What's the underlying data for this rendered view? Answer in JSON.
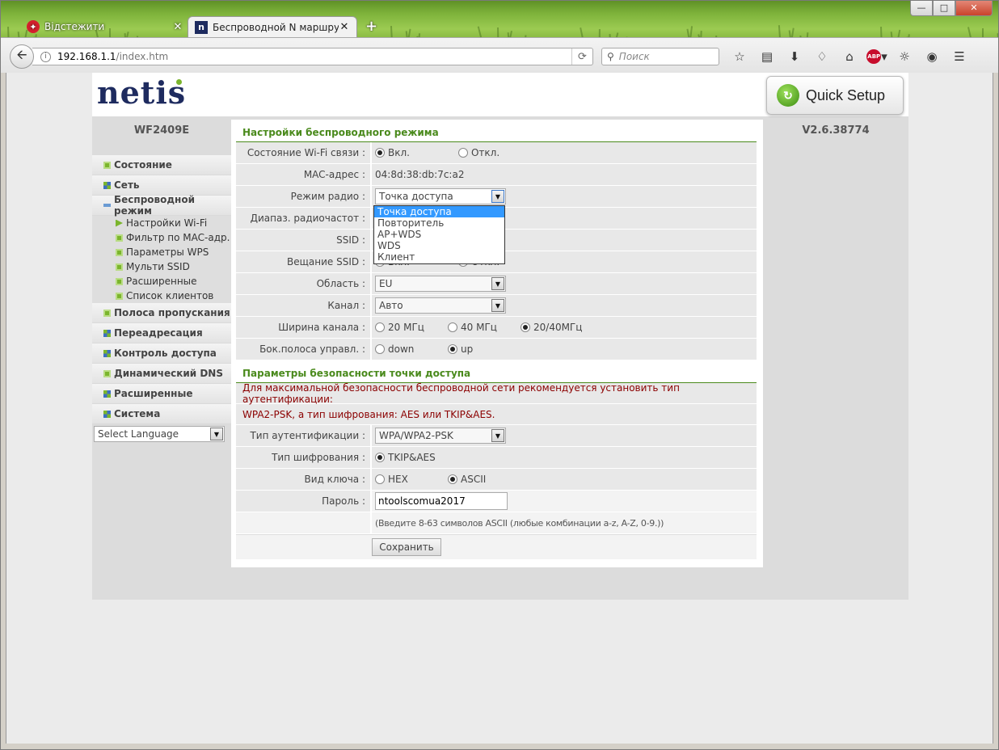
{
  "browser": {
    "tabs": [
      {
        "title": "Відстежити",
        "icon": "vivaldi-icon"
      },
      {
        "title": "Беспроводной N маршру...",
        "icon": "netis-favicon"
      }
    ],
    "url_host": "192.168.1.1",
    "url_path": "/index.htm",
    "search_placeholder": "Поиск",
    "abp_label": "ABP"
  },
  "header": {
    "logo": "netis",
    "quick_setup": "Quick Setup"
  },
  "sidebar": {
    "model": "WF2409E",
    "items": [
      {
        "label": "Состояние",
        "icon": "plus"
      },
      {
        "label": "Сеть",
        "icon": "grid"
      },
      {
        "label": "Беспроводной режим",
        "icon": "minus"
      }
    ],
    "subitems": [
      {
        "label": "Настройки Wi-Fi"
      },
      {
        "label": "Фильтр по MAC-адр."
      },
      {
        "label": "Параметры WPS"
      },
      {
        "label": "Мульти SSID"
      },
      {
        "label": "Расширенные"
      },
      {
        "label": "Список клиентов"
      }
    ],
    "items2": [
      {
        "label": "Полоса пропускания",
        "icon": "plus"
      },
      {
        "label": "Переадресация",
        "icon": "grid"
      },
      {
        "label": "Контроль доступа",
        "icon": "grid"
      },
      {
        "label": "Динамический DNS",
        "icon": "plus"
      },
      {
        "label": "Расширенные",
        "icon": "grid"
      },
      {
        "label": "Система",
        "icon": "grid"
      }
    ],
    "language": "Select Language"
  },
  "version": "V2.6.38774",
  "wireless": {
    "section_title": "Настройки беспроводного режима",
    "wifi_status_label": "Состояние Wi-Fi связи :",
    "wifi_on": "Вкл.",
    "wifi_off": "Откл.",
    "mac_label": "MAC-адрес :",
    "mac_value": "04:8d:38:db:7c:a2",
    "radio_mode_label": "Режим радио :",
    "radio_mode_value": "Точка доступа",
    "range_label": "Диапаз. радиочастот :",
    "ssid_label": "SSID :",
    "broadcast_label": "Вещание SSID :",
    "broadcast_on": "Вкл.",
    "broadcast_off": "Откл.",
    "region_label": "Область :",
    "region_value": "EU",
    "channel_label": "Канал :",
    "channel_value": "Авто",
    "width_label": "Ширина канала :",
    "width_20": "20 МГц",
    "width_40": "40 МГц",
    "width_2040": "20/40МГц",
    "sideband_label": "Бок.полоса управл. :",
    "sideband_down": "down",
    "sideband_up": "up"
  },
  "radio_mode_options": [
    "Точка доступа",
    "Повторитель",
    "AP+WDS",
    "WDS",
    "Клиент"
  ],
  "security": {
    "section_title": "Параметры безопасности точки доступа",
    "warning_1": "Для максимальной безопасности беспроводной сети рекомендуется установить тип аутентификации:",
    "warning_2": "WPA2-PSK, а тип шифрования: AES или TKIP&AES.",
    "auth_label": "Тип аутентификации :",
    "auth_value": "WPA/WPA2-PSK",
    "cipher_label": "Тип шифрования :",
    "cipher_value": "TKIP&AES",
    "key_label": "Вид ключа :",
    "key_hex": "HEX",
    "key_ascii": "ASCII",
    "password_label": "Пароль :",
    "password_value": "ntoolscomua2017",
    "hint": "(Введите 8-63 символов ASCII (любые комбинации a-z, A-Z, 0-9.))",
    "save": "Сохранить"
  }
}
